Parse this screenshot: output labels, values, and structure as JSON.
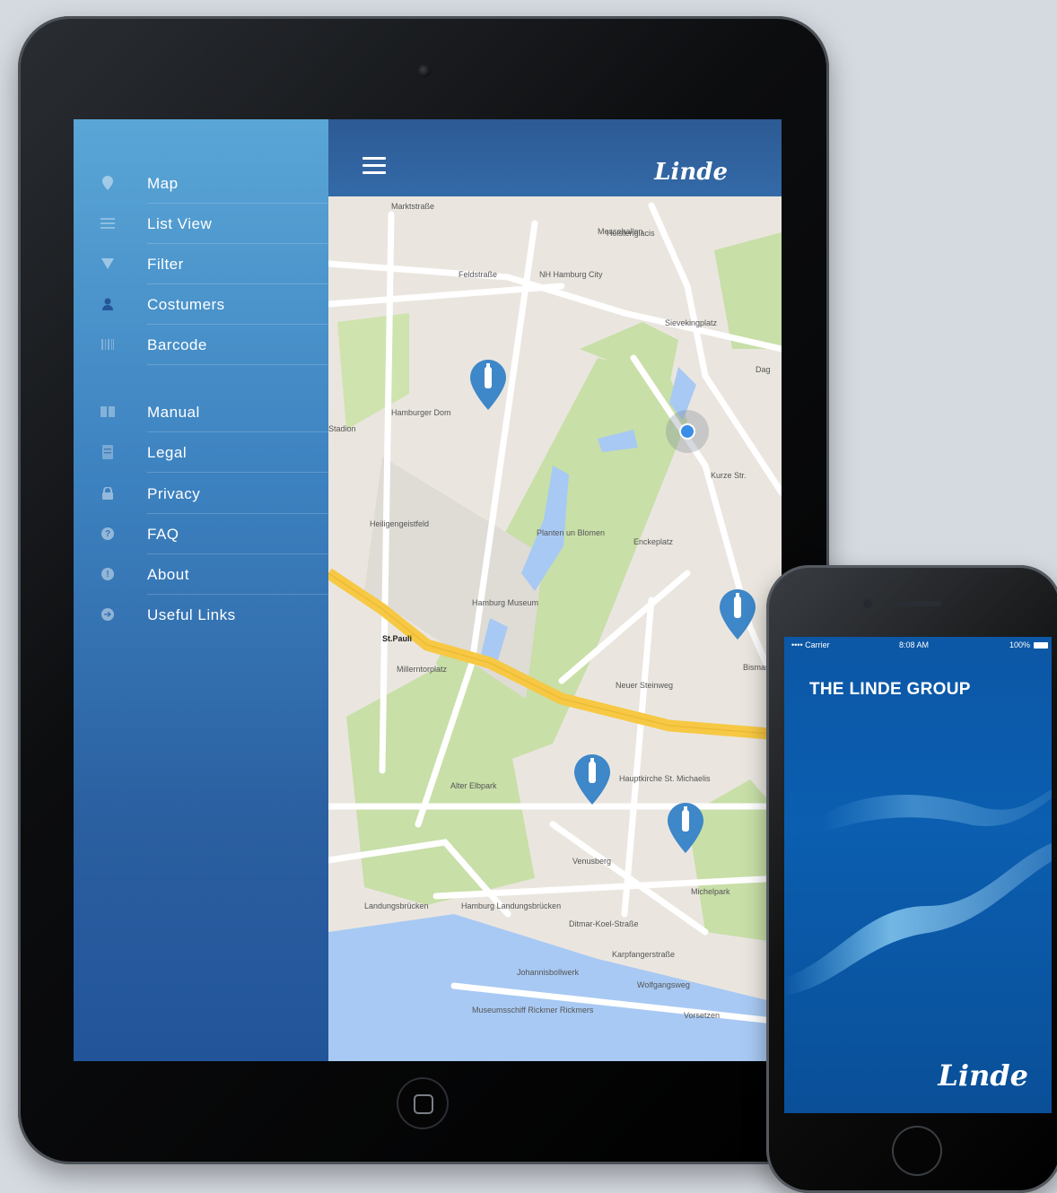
{
  "tablet": {
    "header": {
      "brand": "Linde"
    },
    "sidebar": {
      "items": [
        {
          "label": "Map",
          "icon": "map-pin-icon"
        },
        {
          "label": "List View",
          "icon": "list-icon"
        },
        {
          "label": "Filter",
          "icon": "filter-icon"
        },
        {
          "label": "Costumers",
          "icon": "person-icon"
        },
        {
          "label": "Barcode",
          "icon": "barcode-icon"
        },
        {
          "label": "Manual",
          "icon": "book-icon"
        },
        {
          "label": "Legal",
          "icon": "document-icon"
        },
        {
          "label": "Privacy",
          "icon": "lock-icon"
        },
        {
          "label": "FAQ",
          "icon": "question-icon"
        },
        {
          "label": "About",
          "icon": "info-icon"
        },
        {
          "label": "Useful Links",
          "icon": "arrow-right-icon"
        }
      ]
    },
    "map": {
      "labels": [
        "Marktstraße",
        "Messehallen",
        "Feldstraße",
        "NH Hamburg City",
        "Sievekingplatz",
        "Hamburger Dom",
        "Heiligengeistfeld",
        "Planten un Blomen",
        "Hamburg Museum",
        "St.Pauli",
        "Millerntorplatz",
        "Neuer Steinweg",
        "Hauptkirche St. Michaelis",
        "Alter Elbpark",
        "Landungsbrücken",
        "Hamburg Landungsbrücken",
        "Johannisbollwerk",
        "Venusberg",
        "Michelpark",
        "Vorsetzen",
        "Kurze Str.",
        "Enckeplatz",
        "Karpfangerstraße",
        "Wolfgangsweg",
        "Museumsschiff Rickmer Rickmers",
        "Ditmar-Koel-Straße",
        "Holstenglacis",
        "Bismarck",
        "Stadion",
        "Dag"
      ]
    }
  },
  "phone": {
    "status": {
      "carrier": "•••• Carrier",
      "time": "8:08 AM",
      "battery": "100%"
    },
    "title": "THE LINDE GROUP",
    "logo": "Linde"
  }
}
